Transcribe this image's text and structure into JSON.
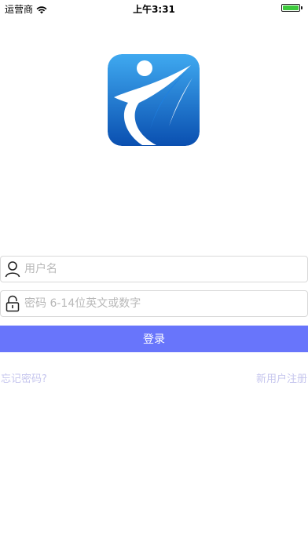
{
  "status_bar": {
    "carrier": "运营商",
    "time": "上午3:31",
    "battery_level": 1.0,
    "battery_color": "#3cc93c"
  },
  "logo": {
    "icon": "app-logo-icon",
    "gradient_top": "#3fa9f0",
    "gradient_bottom": "#0a4fb0"
  },
  "form": {
    "username": {
      "placeholder": "用户名",
      "icon": "user-icon",
      "value": ""
    },
    "password": {
      "placeholder": "密码 6-14位英文或数字",
      "icon": "lock-icon",
      "value": ""
    },
    "login_label": "登录",
    "login_color": "#6875fb"
  },
  "links": {
    "forgot_password": "忘记密码?",
    "register": "新用户注册",
    "link_color": "#c6c6ee"
  }
}
